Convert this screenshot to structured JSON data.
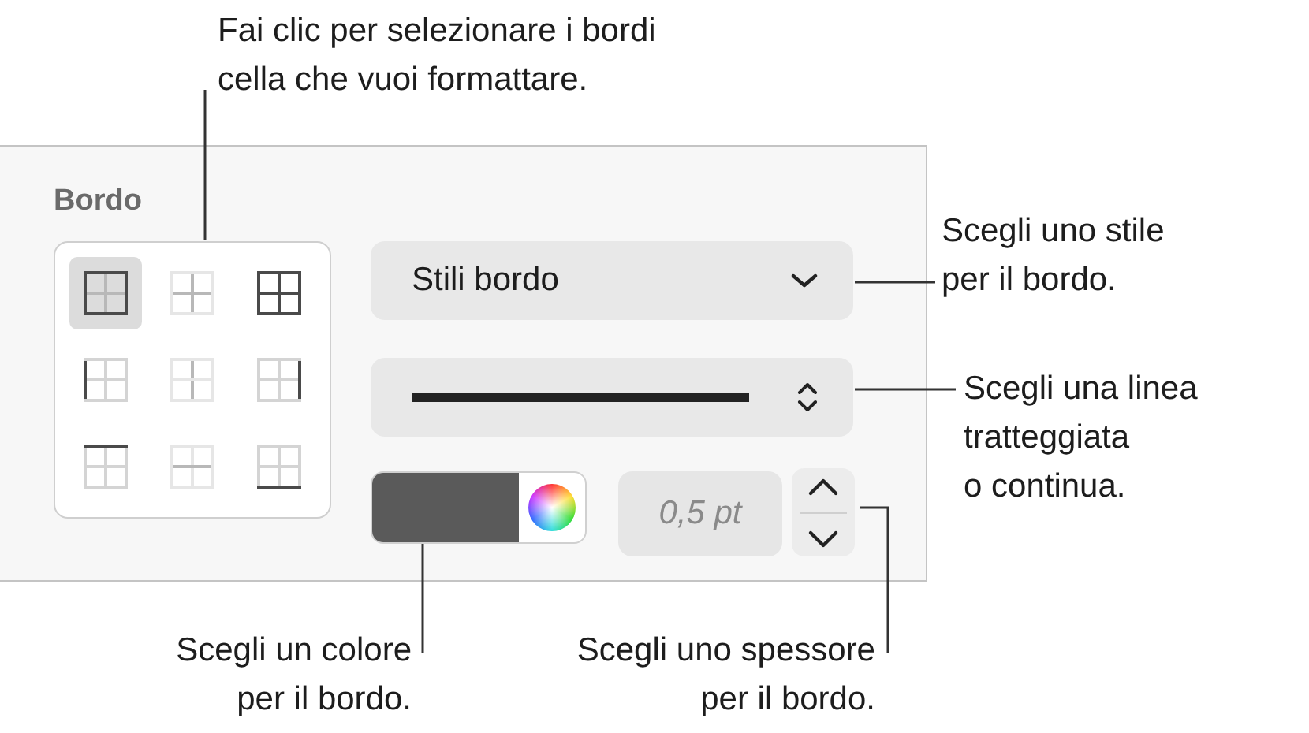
{
  "callouts": [
    {
      "text": "Fai clic per selezionare i bordi\ncella che vuoi formattare.",
      "kind": "top"
    },
    {
      "text": "Scegli uno stile\nper il bordo.",
      "kind": "style"
    },
    {
      "text": "Scegli una linea\ntratteggiata\no continua.",
      "kind": "line"
    },
    {
      "text": "Scegli un colore\nper il bordo.",
      "kind": "color"
    },
    {
      "text": "Scegli uno spessore\nper il bordo.",
      "kind": "width"
    }
  ],
  "panel": {
    "title": "Bordo",
    "border_buttons": [
      {
        "kind": "outer",
        "selected": true
      },
      {
        "kind": "inner",
        "selected": false
      },
      {
        "kind": "all",
        "selected": false
      },
      {
        "kind": "left",
        "selected": false
      },
      {
        "kind": "vertical-inner",
        "selected": false
      },
      {
        "kind": "right",
        "selected": false
      },
      {
        "kind": "top",
        "selected": false
      },
      {
        "kind": "horizontal-inner",
        "selected": false
      },
      {
        "kind": "bottom",
        "selected": false
      }
    ],
    "style_popup": {
      "value": "Stili bordo"
    },
    "color_well": {
      "color": "#5a5a5a"
    },
    "width_field": {
      "value": "0,5 pt"
    }
  }
}
